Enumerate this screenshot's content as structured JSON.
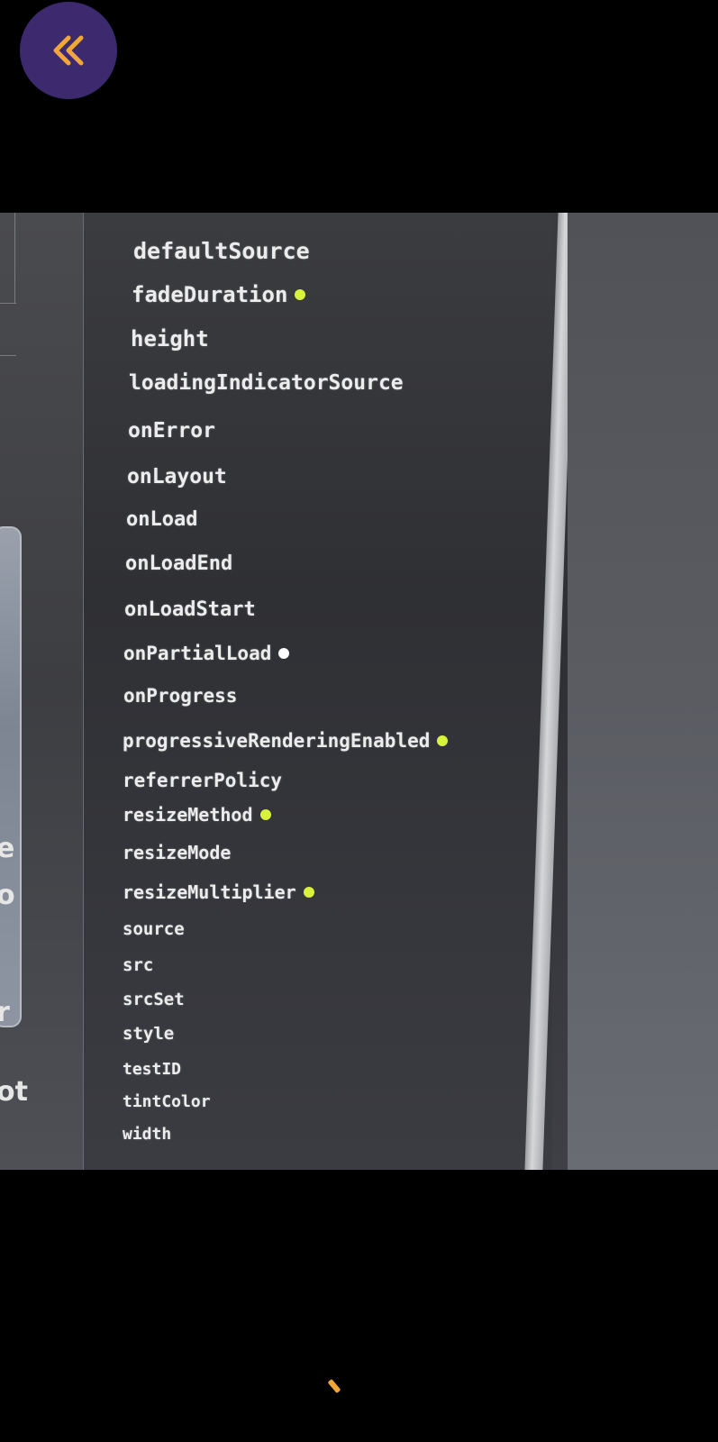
{
  "back_button": {
    "icon": "double-chevron-left-icon",
    "color": "#f2a63a",
    "background": "#3d2a6e"
  },
  "left_edge_chars": [
    "e",
    "o",
    "r",
    "ot"
  ],
  "properties": [
    {
      "name": "defaultSource",
      "dot": null
    },
    {
      "name": "fadeDuration",
      "dot": "#d9f23a"
    },
    {
      "name": "height",
      "dot": null
    },
    {
      "name": "loadingIndicatorSource",
      "dot": null
    },
    {
      "name": "onError",
      "dot": null
    },
    {
      "name": "onLayout",
      "dot": null
    },
    {
      "name": "onLoad",
      "dot": null
    },
    {
      "name": "onLoadEnd",
      "dot": null
    },
    {
      "name": "onLoadStart",
      "dot": null
    },
    {
      "name": "onPartialLoad",
      "dot": "#ffffff"
    },
    {
      "name": "onProgress",
      "dot": null
    },
    {
      "name": "progressiveRenderingEnabled",
      "dot": "#d9f23a"
    },
    {
      "name": "referrerPolicy",
      "dot": null
    },
    {
      "name": "resizeMethod",
      "dot": "#d9f23a"
    },
    {
      "name": "resizeMode",
      "dot": null
    },
    {
      "name": "resizeMultiplier",
      "dot": "#d9f23a"
    },
    {
      "name": "source",
      "dot": null
    },
    {
      "name": "src",
      "dot": null
    },
    {
      "name": "srcSet",
      "dot": null
    },
    {
      "name": "style",
      "dot": null
    },
    {
      "name": "testID",
      "dot": null
    },
    {
      "name": "tintColor",
      "dot": null
    },
    {
      "name": "width",
      "dot": null
    }
  ]
}
